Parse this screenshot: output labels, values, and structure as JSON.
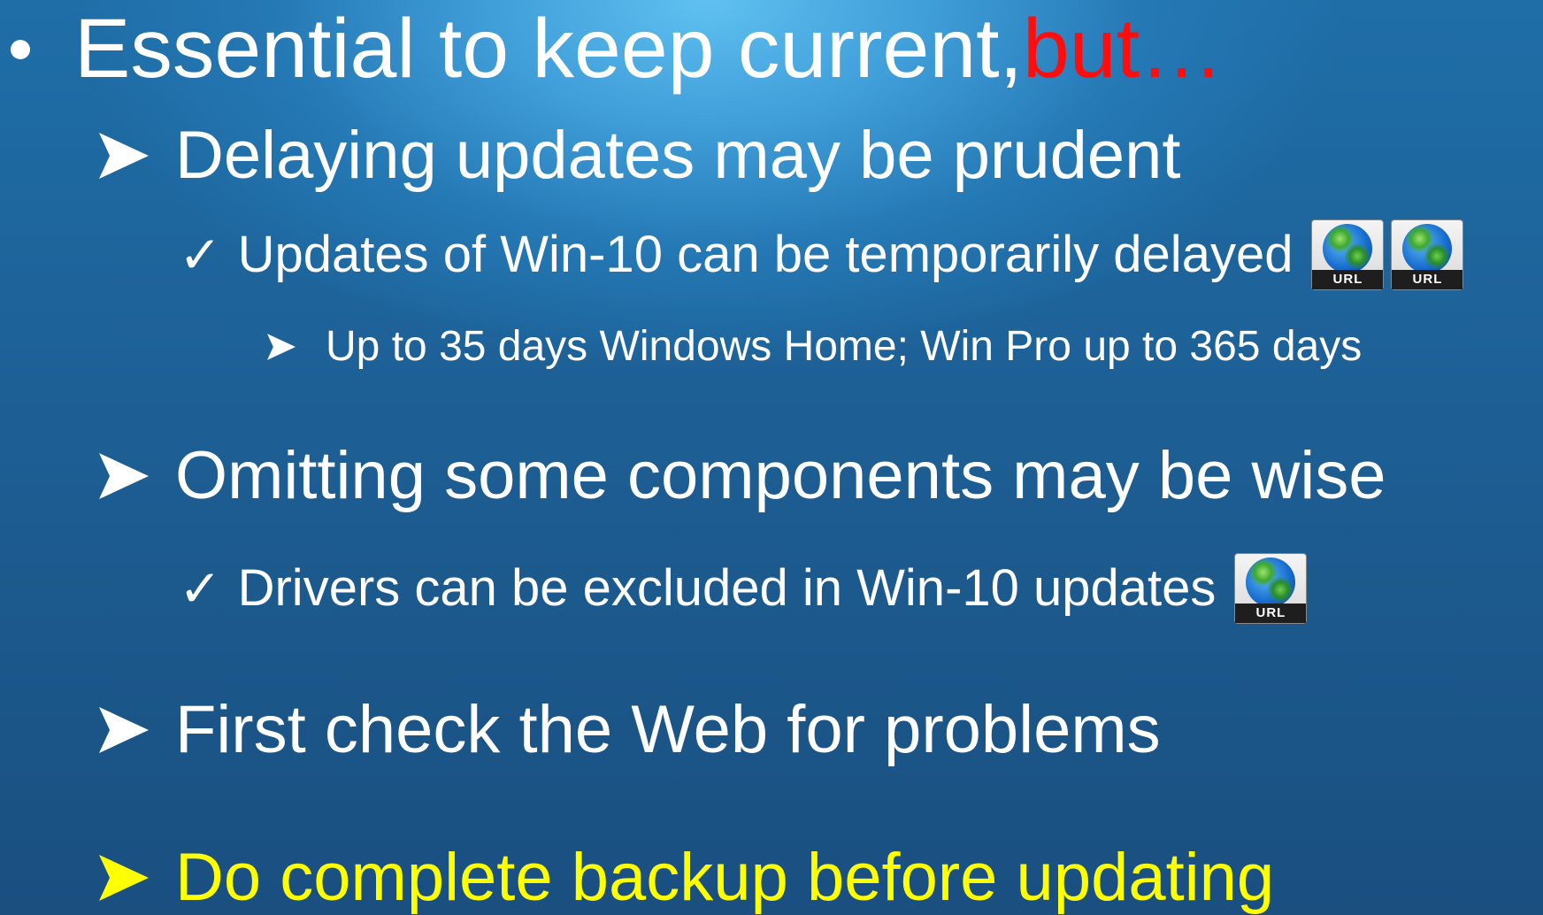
{
  "slide": {
    "heading": {
      "text_main": "Essential to keep current, ",
      "text_emphasis": "but…",
      "emphasis_color": "#ff0d0d"
    },
    "items": [
      {
        "text": "Delaying updates may be prudent",
        "children": [
          {
            "text": "Updates of Win-10 can be temporarily delayed",
            "icons": [
              "URL",
              "URL"
            ],
            "children": [
              {
                "text": "Up to 35 days Windows Home; Win Pro up to 365 days"
              }
            ]
          }
        ]
      },
      {
        "text": "Omitting some components may be wise",
        "children": [
          {
            "text": "Drivers can be excluded in Win-10 updates",
            "icons": [
              "URL"
            ]
          }
        ]
      },
      {
        "text": "First check the Web for problems"
      },
      {
        "text": "Do complete backup before updating",
        "color": "#ffff00"
      }
    ],
    "icon_semantics": {
      "bullet": "bullet-dot-icon",
      "arrow": "arrow-bullet-icon",
      "check": "checkmark-icon",
      "link": "url-globe-icon"
    }
  }
}
